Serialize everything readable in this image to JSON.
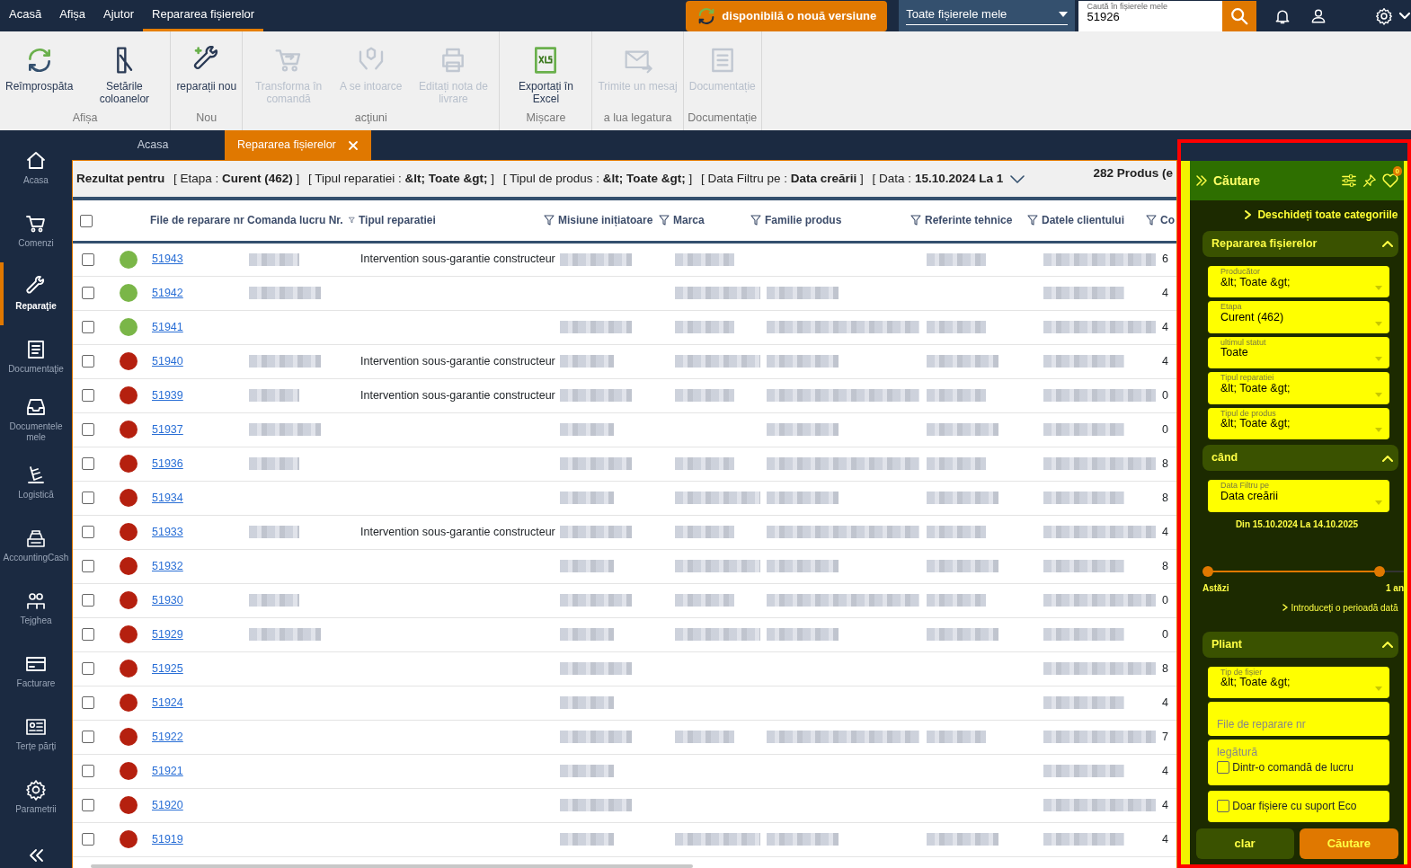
{
  "menu": [
    {
      "label": "Acasă",
      "selected": false
    },
    {
      "label": "Afișa",
      "selected": false
    },
    {
      "label": "Ajutor",
      "selected": false
    },
    {
      "label": "Repararea fișierelor",
      "selected": true
    }
  ],
  "update_button": "disponibilă o nouă versiune",
  "scope_select": {
    "value": "Toate fișierele mele"
  },
  "search": {
    "label": "Caută în fișierele mele",
    "value": "51926"
  },
  "ribbon": [
    {
      "label": "Afișa",
      "buttons": [
        {
          "label": "Reîmprospăta",
          "disabled": false
        },
        {
          "label": "Setările coloanelor",
          "disabled": false
        }
      ]
    },
    {
      "label": "Nou",
      "buttons": [
        {
          "label": "reparații nou",
          "disabled": false
        }
      ]
    },
    {
      "label": "acţiuni",
      "buttons": [
        {
          "label": "Transforma în comandă",
          "disabled": true
        },
        {
          "label": "A se intoarce",
          "disabled": true
        },
        {
          "label": "Editați nota de livrare",
          "disabled": true
        }
      ]
    },
    {
      "label": "Mișcare",
      "buttons": [
        {
          "label": "Exportați în Excel",
          "disabled": false
        }
      ]
    },
    {
      "label": "a lua legatura",
      "buttons": [
        {
          "label": "Trimite un mesaj",
          "disabled": true
        }
      ]
    },
    {
      "label": "Documentație",
      "buttons": [
        {
          "label": "Documentație",
          "disabled": true
        }
      ]
    }
  ],
  "sidebar": {
    "items": [
      {
        "label": "Acasa",
        "selected": false
      },
      {
        "label": "Comenzi",
        "selected": false
      },
      {
        "label": "Reparaţie",
        "selected": true
      },
      {
        "label": "Documentaţie",
        "selected": false
      },
      {
        "label": "Documentele mele",
        "selected": false
      },
      {
        "label": "Logistică",
        "selected": false
      },
      {
        "label": "AccountingCash",
        "selected": false
      },
      {
        "label": "Tejghea",
        "selected": false
      },
      {
        "label": "Facturare",
        "selected": false
      },
      {
        "label": "Terțe părți",
        "selected": false
      },
      {
        "label": "Parametrii",
        "selected": false
      }
    ]
  },
  "tabs": [
    {
      "label": "Acasa",
      "selected": false,
      "closable": false
    },
    {
      "label": "Repararea fișierelor",
      "selected": true,
      "closable": true
    }
  ],
  "summary": {
    "title": "Rezultat pentru",
    "filters": [
      {
        "label": "[ Etapa :",
        "value": "Curent (462)",
        "close": "]"
      },
      {
        "label": "[ Tipul reparatiei :",
        "value": "&lt; Toate &gt;",
        "close": "]"
      },
      {
        "label": "[ Tipul de produs :",
        "value": "&lt; Toate &gt;",
        "close": "]"
      },
      {
        "label": "[ Data Filtru pe :",
        "value": "Data creării",
        "close": "]"
      },
      {
        "label": "[ Data :",
        "value": "15.10.2024 La 1"
      }
    ],
    "count": "282 Produs (e"
  },
  "table": {
    "all_checked": false,
    "columns": [
      {
        "label": "File de reparare nr",
        "kind": "plain"
      },
      {
        "label": "Comanda lucru Nr.",
        "kind": "filter"
      },
      {
        "label": "Tipul reparatiei",
        "kind": "filter"
      },
      {
        "label": "Misiune inițiatoare",
        "kind": "filter"
      },
      {
        "label": "Marca",
        "kind": "filter"
      },
      {
        "label": "Familie produs",
        "kind": "filter"
      },
      {
        "label": "Referinte tehnice",
        "kind": "filter"
      },
      {
        "label": "Datele clientului",
        "kind": "filter"
      },
      {
        "label": "Co",
        "kind": "plain"
      }
    ],
    "rows": [
      {
        "checked": false,
        "number": "51943",
        "color": "#7ab648",
        "type": "Intervention sous-garantie constructeur",
        "cells": [
          {
            "kind": "blurred"
          },
          {
            "kind": "blurred"
          },
          {
            "kind": "blurred"
          },
          {
            "kind": "blank"
          },
          {
            "kind": "blurred"
          },
          {
            "kind": "blurred"
          }
        ],
        "column_9": "6"
      },
      {
        "checked": false,
        "number": "51942",
        "color": "#7ab648",
        "cells": [
          {
            "kind": "blurred"
          },
          {
            "kind": "blank"
          },
          {
            "kind": "blurred"
          },
          {
            "kind": "blurred"
          },
          {
            "kind": "blank"
          },
          {
            "kind": "blurred"
          }
        ],
        "column_9": "4"
      },
      {
        "checked": false,
        "number": "51941",
        "color": "#7ab648",
        "cells": [
          {
            "kind": "blank"
          },
          {
            "kind": "blurred"
          },
          {
            "kind": "blurred"
          },
          {
            "kind": "blurred"
          },
          {
            "kind": "blurred"
          },
          {
            "kind": "blurred"
          }
        ],
        "column_9": "4"
      },
      {
        "checked": false,
        "number": "51940",
        "color": "#b5200f",
        "type": "Intervention sous-garantie constructeur",
        "cells": [
          {
            "kind": "blurred"
          },
          {
            "kind": "blurred"
          },
          {
            "kind": "blurred"
          },
          {
            "kind": "blurred"
          },
          {
            "kind": "blurred"
          },
          {
            "kind": "blurred"
          }
        ],
        "column_9": "4"
      },
      {
        "checked": false,
        "number": "51939",
        "color": "#b5200f",
        "type": "Intervention sous-garantie constructeur",
        "cells": [
          {
            "kind": "blurred"
          },
          {
            "kind": "blurred"
          },
          {
            "kind": "blurred"
          },
          {
            "kind": "blurred"
          },
          {
            "kind": "blurred"
          },
          {
            "kind": "blurred"
          }
        ],
        "column_9": "0"
      },
      {
        "checked": false,
        "number": "51937",
        "color": "#b5200f",
        "cells": [
          {
            "kind": "blurred"
          },
          {
            "kind": "blurred"
          },
          {
            "kind": "blank"
          },
          {
            "kind": "blurred"
          },
          {
            "kind": "blurred"
          },
          {
            "kind": "blurred"
          }
        ],
        "column_9": "0"
      },
      {
        "checked": false,
        "number": "51936",
        "color": "#b5200f",
        "cells": [
          {
            "kind": "blurred"
          },
          {
            "kind": "blurred"
          },
          {
            "kind": "blurred"
          },
          {
            "kind": "blurred"
          },
          {
            "kind": "blurred"
          },
          {
            "kind": "blurred"
          }
        ],
        "column_9": "8"
      },
      {
        "checked": false,
        "number": "51934",
        "color": "#b5200f",
        "cells": [
          {
            "kind": "blank"
          },
          {
            "kind": "blurred"
          },
          {
            "kind": "blurred"
          },
          {
            "kind": "blurred"
          },
          {
            "kind": "blurred"
          },
          {
            "kind": "blurred"
          }
        ],
        "column_9": "8"
      },
      {
        "checked": false,
        "number": "51933",
        "color": "#b5200f",
        "type": "Intervention sous-garantie constructeur",
        "cells": [
          {
            "kind": "blurred"
          },
          {
            "kind": "blurred"
          },
          {
            "kind": "blurred"
          },
          {
            "kind": "blurred"
          },
          {
            "kind": "blurred"
          },
          {
            "kind": "blurred"
          }
        ],
        "column_9": "4"
      },
      {
        "checked": false,
        "number": "51932",
        "color": "#b5200f",
        "cells": [
          {
            "kind": "blank"
          },
          {
            "kind": "blurred"
          },
          {
            "kind": "blurred"
          },
          {
            "kind": "blurred"
          },
          {
            "kind": "blurred"
          },
          {
            "kind": "blurred"
          }
        ],
        "column_9": "8"
      },
      {
        "checked": false,
        "number": "51930",
        "color": "#b5200f",
        "cells": [
          {
            "kind": "blurred"
          },
          {
            "kind": "blurred"
          },
          {
            "kind": "blurred"
          },
          {
            "kind": "blurred"
          },
          {
            "kind": "blurred"
          },
          {
            "kind": "blurred"
          }
        ],
        "column_9": "0"
      },
      {
        "checked": false,
        "number": "51929",
        "color": "#b5200f",
        "cells": [
          {
            "kind": "blurred"
          },
          {
            "kind": "blurred"
          },
          {
            "kind": "blurred"
          },
          {
            "kind": "blurred"
          },
          {
            "kind": "blurred"
          },
          {
            "kind": "blurred"
          }
        ],
        "column_9": "0"
      },
      {
        "checked": false,
        "number": "51925",
        "color": "#b5200f",
        "cells": [
          {
            "kind": "blank"
          },
          {
            "kind": "blurred"
          },
          {
            "kind": "blank"
          },
          {
            "kind": "blank"
          },
          {
            "kind": "blank"
          },
          {
            "kind": "blurred"
          }
        ],
        "column_9": "8"
      },
      {
        "checked": false,
        "number": "51924",
        "color": "#b5200f",
        "cells": [
          {
            "kind": "blank"
          },
          {
            "kind": "blurred"
          },
          {
            "kind": "blank"
          },
          {
            "kind": "blank"
          },
          {
            "kind": "blank"
          },
          {
            "kind": "blurred"
          }
        ],
        "column_9": "4"
      },
      {
        "checked": false,
        "number": "51922",
        "color": "#b5200f",
        "cells": [
          {
            "kind": "blank"
          },
          {
            "kind": "blurred"
          },
          {
            "kind": "blurred"
          },
          {
            "kind": "blurred"
          },
          {
            "kind": "blurred"
          },
          {
            "kind": "blurred"
          }
        ],
        "column_9": "7"
      },
      {
        "checked": false,
        "number": "51921",
        "color": "#b5200f",
        "cells": [
          {
            "kind": "blank"
          },
          {
            "kind": "blurred"
          },
          {
            "kind": "blank"
          },
          {
            "kind": "blank"
          },
          {
            "kind": "blank"
          },
          {
            "kind": "blurred"
          }
        ],
        "column_9": "4"
      },
      {
        "checked": false,
        "number": "51920",
        "color": "#b5200f",
        "cells": [
          {
            "kind": "blank"
          },
          {
            "kind": "blurred"
          },
          {
            "kind": "blank"
          },
          {
            "kind": "blank"
          },
          {
            "kind": "blank"
          },
          {
            "kind": "blurred"
          }
        ],
        "column_9": "4"
      },
      {
        "checked": false,
        "number": "51919",
        "color": "#b5200f",
        "cells": [
          {
            "kind": "blank"
          },
          {
            "kind": "blurred"
          },
          {
            "kind": "blurred"
          },
          {
            "kind": "blurred"
          },
          {
            "kind": "blurred"
          },
          {
            "kind": "blurred"
          }
        ],
        "column_9": "4"
      }
    ]
  },
  "search_panel": {
    "title": "Căutare",
    "favorites_count": "0",
    "open_all": "Deschideți toate categoriile",
    "sections": [
      {
        "title": "Repararea fișierelor",
        "expanded": true,
        "fields": [
          {
            "kind": "select",
            "label": "Producător",
            "value": "&lt; Toate &gt;"
          },
          {
            "kind": "select",
            "label": "Etapa",
            "value": "Curent (462)"
          },
          {
            "kind": "select",
            "label": "ultimul statut",
            "value": "Toate"
          },
          {
            "kind": "select",
            "label": "Tipul reparatiei",
            "value": "&lt; Toate &gt;"
          },
          {
            "kind": "select",
            "label": "Tipul de produs",
            "value": "&lt; Toate &gt;"
          }
        ]
      },
      {
        "title": "când",
        "expanded": true,
        "fields": [
          {
            "kind": "select",
            "label": "Data Filtru pe",
            "value": "Data creării"
          },
          {
            "kind": "range",
            "text": "Din 15.10.2024 La 14.10.2025",
            "level": 0.88,
            "min_label": "Astăzi",
            "max_label": "1 an",
            "link": "Introduceți o perioadă dată"
          }
        ]
      },
      {
        "title": "Pliant",
        "expanded": true,
        "fields": [
          {
            "kind": "select",
            "label": "Tip de fișier",
            "value": "&lt; Toate &gt;"
          },
          {
            "kind": "text",
            "placeholder": "File de reparare nr"
          },
          {
            "kind": "group",
            "label": "legătură",
            "checkbox": "Dintr-o comandă de lucru",
            "checked": false
          },
          {
            "kind": "checkbox",
            "checkbox": "Doar fișiere cu suport Eco",
            "checked": false
          }
        ]
      }
    ],
    "buttons": [
      {
        "label": "clar",
        "kind": "secondary"
      },
      {
        "label": "Căutare",
        "kind": "primary"
      }
    ]
  }
}
